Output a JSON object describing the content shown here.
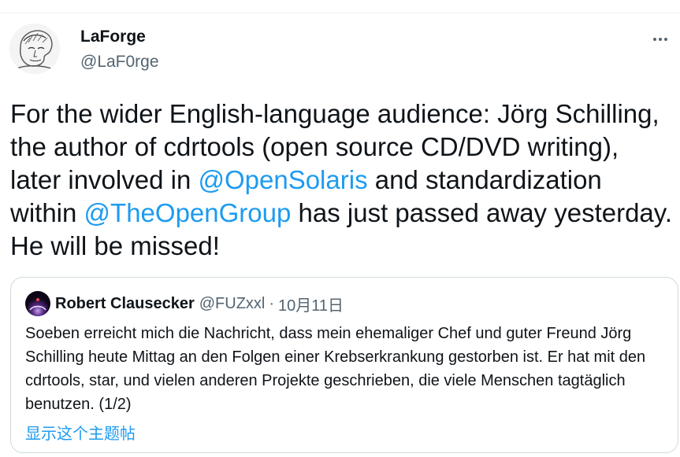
{
  "tweet": {
    "author": {
      "display_name": "LaForge",
      "handle": "@LaF0rge"
    },
    "more_icon": "more-horizontal-icon",
    "text_segments": {
      "s1": "For the wider English-language audience: Jörg Schilling, the author of cdrtools (open source CD/DVD writing),  later involved in ",
      "m1": "@OpenSolaris",
      "s2": " and standardization within ",
      "m2": "@TheOpenGroup",
      "s3": " has just passed away yesterday. He will be missed!"
    }
  },
  "quote": {
    "author": {
      "display_name": "Robert Clausecker",
      "handle": "@FUZxxl",
      "separator": "·",
      "date": "10月11日"
    },
    "text": "Soeben erreicht mich die Nachricht, dass mein ehemaliger Chef und guter Freund Jörg Schilling heute Mittag an den Folgen einer Krebserkrankung gestorben ist.  Er hat mit den cdrtools, star, und vielen anderen Projekte geschrieben, die viele Menschen tagtäglich benutzen.  (1/2)",
    "show_thread": "显示这个主题帖"
  },
  "colors": {
    "text": "#0f1419",
    "secondary": "#536471",
    "link": "#1d9bf0",
    "border": "#cfd9de"
  }
}
